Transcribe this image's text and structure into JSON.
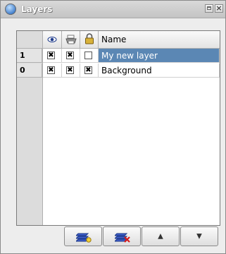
{
  "window": {
    "title": "Layers"
  },
  "table": {
    "header": {
      "vis_icon": "eye-icon",
      "print_icon": "printer-icon",
      "lock_icon": "lock-icon",
      "name": "Name"
    },
    "rows": [
      {
        "number": "1",
        "visible": "✖",
        "printable": "✖",
        "locked": "",
        "name": "My new layer",
        "selected": true
      },
      {
        "number": "0",
        "visible": "✖",
        "printable": "✖",
        "locked": "✖",
        "name": "Background",
        "selected": false
      }
    ]
  },
  "toolbar": {
    "new_icon": "new-layer-icon",
    "delete_icon": "delete-layer-icon",
    "up_icon": "▲",
    "down_icon": "▼"
  },
  "colors": {
    "selection": "#5b87b4",
    "accent": "#3a78c8"
  }
}
